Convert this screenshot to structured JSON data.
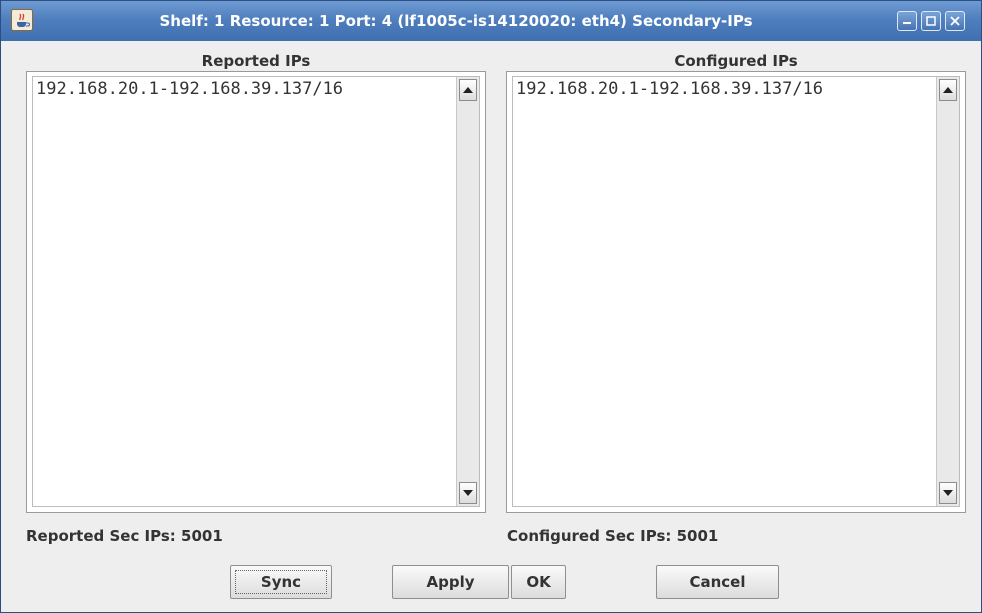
{
  "window": {
    "title": "Shelf: 1 Resource: 1 Port: 4 (lf1005c-is14120020: eth4) Secondary-IPs",
    "icon": "java-cup-icon",
    "controls": [
      "minimize-icon",
      "maximize-icon",
      "close-icon"
    ],
    "accent": "#4f7fbe"
  },
  "reported": {
    "title": "Reported IPs",
    "items": [
      "192.168.20.1-192.168.39.137/16"
    ],
    "count_label": "Reported Sec IPs: 5001"
  },
  "configured": {
    "title": "Configured IPs",
    "items": [
      "192.168.20.1-192.168.39.137/16"
    ],
    "count_label": "Configured Sec IPs: 5001"
  },
  "buttons": {
    "sync": "Sync",
    "apply": "Apply",
    "ok": "OK",
    "cancel": "Cancel"
  }
}
